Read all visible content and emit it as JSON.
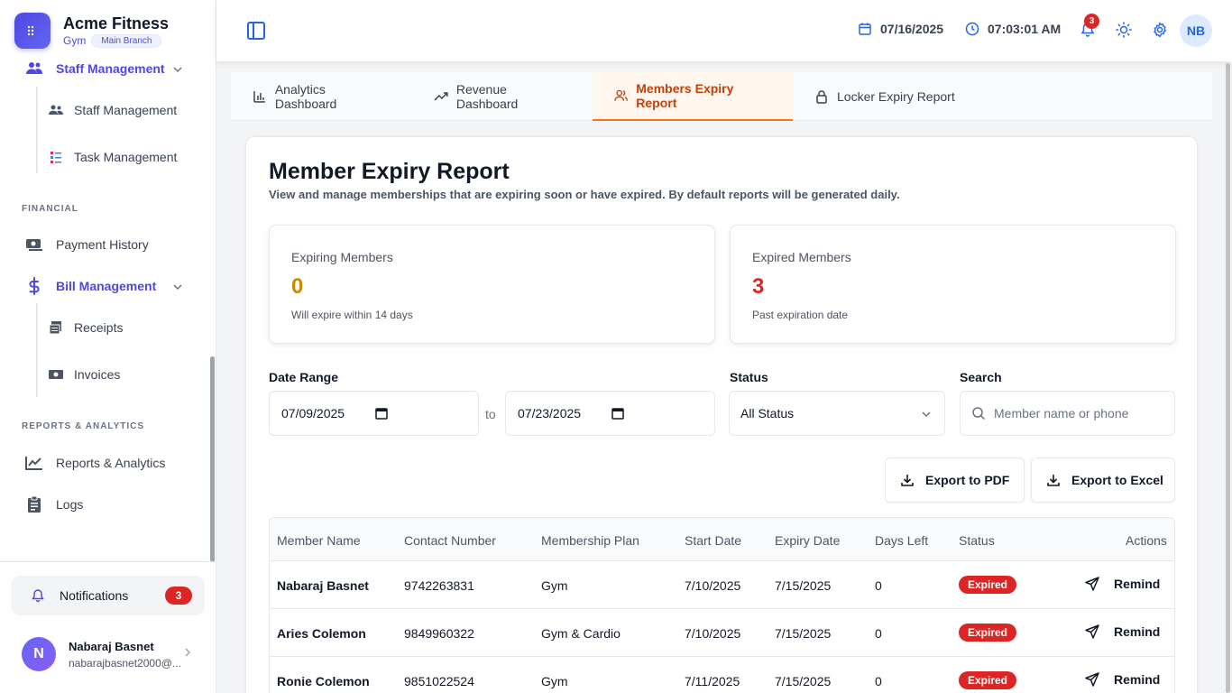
{
  "brand": {
    "name": "Acme Fitness",
    "type": "Gym",
    "branch": "Main Branch"
  },
  "sidebar": {
    "staff_group": "Staff Management",
    "staff_items": [
      "Staff Management",
      "Task Management"
    ],
    "financial_label": "FINANCIAL",
    "payment_history": "Payment History",
    "bill_group": "Bill Management",
    "bill_items": [
      "Receipts",
      "Invoices"
    ],
    "reports_label": "REPORTS & ANALYTICS",
    "reports": "Reports & Analytics",
    "logs": "Logs",
    "notifications_label": "Notifications",
    "notifications_count": "3",
    "user_initial": "N",
    "user_name": "Nabaraj Basnet",
    "user_email": "nabarajbasnet2000@..."
  },
  "header": {
    "date": "07/16/2025",
    "time": "07:03:01 AM",
    "bell_count": "3",
    "avatar": "NB"
  },
  "tabs": [
    {
      "label": "Analytics Dashboard",
      "icon": "bar-chart-icon"
    },
    {
      "label": "Revenue Dashboard",
      "icon": "trending-up-icon"
    },
    {
      "label": "Members Expiry Report",
      "icon": "users-icon",
      "active": true
    },
    {
      "label": "Locker Expiry Report",
      "icon": "lock-icon"
    }
  ],
  "report": {
    "title": "Member Expiry Report",
    "subtitle": "View and manage memberships that are expiring soon or have expired. By default reports will be generated daily.",
    "expiring": {
      "label": "Expiring Members",
      "value": "0",
      "note": "Will expire within 14 days",
      "color": "#ca8a04"
    },
    "expired": {
      "label": "Expired Members",
      "value": "3",
      "note": "Past expiration date",
      "color": "#dc2626"
    }
  },
  "filters": {
    "date_range_label": "Date Range",
    "date_from": "07/09/2025",
    "to_label": "to",
    "date_to": "07/23/2025",
    "status_label": "Status",
    "status_value": "All Status",
    "search_label": "Search",
    "search_placeholder": "Member name or phone"
  },
  "actions": {
    "export_pdf": "Export to PDF",
    "export_excel": "Export to Excel"
  },
  "table": {
    "headers": [
      "Member Name",
      "Contact Number",
      "Membership Plan",
      "Start Date",
      "Expiry Date",
      "Days Left",
      "Status",
      "Actions"
    ],
    "rows": [
      {
        "name": "Nabaraj Basnet",
        "contact": "9742263831",
        "plan": "Gym",
        "start": "7/10/2025",
        "expiry": "7/15/2025",
        "days": "0",
        "status": "Expired",
        "action": "Remind"
      },
      {
        "name": "Aries Colemon",
        "contact": "9849960322",
        "plan": "Gym & Cardio",
        "start": "7/10/2025",
        "expiry": "7/15/2025",
        "days": "0",
        "status": "Expired",
        "action": "Remind"
      },
      {
        "name": "Ronie Colemon",
        "contact": "9851022524",
        "plan": "Gym",
        "start": "7/11/2025",
        "expiry": "7/15/2025",
        "days": "0",
        "status": "Expired",
        "action": "Remind"
      }
    ]
  },
  "colors": {
    "accent": "#4f46e5",
    "tab_active": "#c2410c",
    "danger": "#dc2626",
    "warning": "#ca8a04"
  }
}
